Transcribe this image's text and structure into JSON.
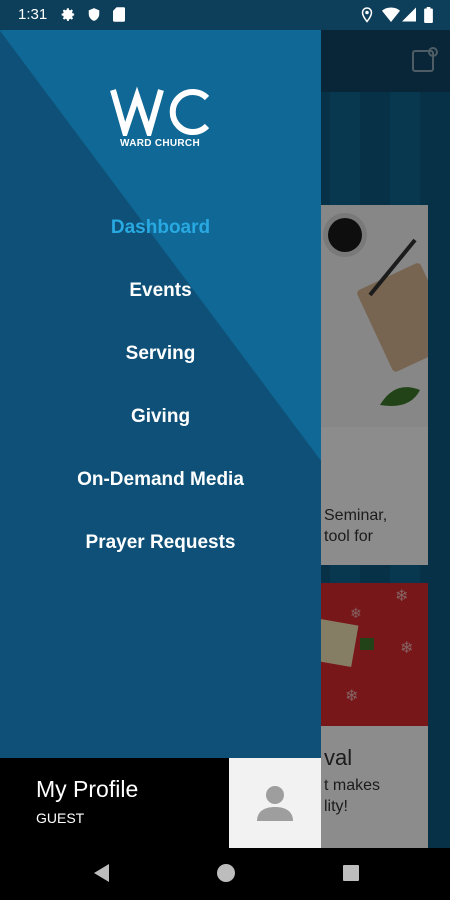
{
  "status_bar": {
    "time": "1:31",
    "left_icons": [
      "settings-icon",
      "shield-icon",
      "sd-card-icon"
    ],
    "right_icons": [
      "location-icon",
      "wifi-icon",
      "signal-icon",
      "battery-icon"
    ]
  },
  "drawer": {
    "logo_text": "WARD CHURCH",
    "menu": [
      {
        "label": "Dashboard",
        "active": true
      },
      {
        "label": "Events",
        "active": false
      },
      {
        "label": "Serving",
        "active": false
      },
      {
        "label": "Giving",
        "active": false
      },
      {
        "label": "On-Demand Media",
        "active": false
      },
      {
        "label": "Prayer Requests",
        "active": false
      }
    ],
    "profile": {
      "name": "My Profile",
      "role": "GUEST"
    }
  },
  "background": {
    "card1": {
      "line1": "Seminar,",
      "line2": "tool for"
    },
    "card2": {
      "title": "val",
      "line1": "t makes",
      "line2": "lity!"
    }
  },
  "colors": {
    "accent": "#29a9e1",
    "drawer_bg": "#0e5077",
    "profile_bg": "#000000"
  }
}
